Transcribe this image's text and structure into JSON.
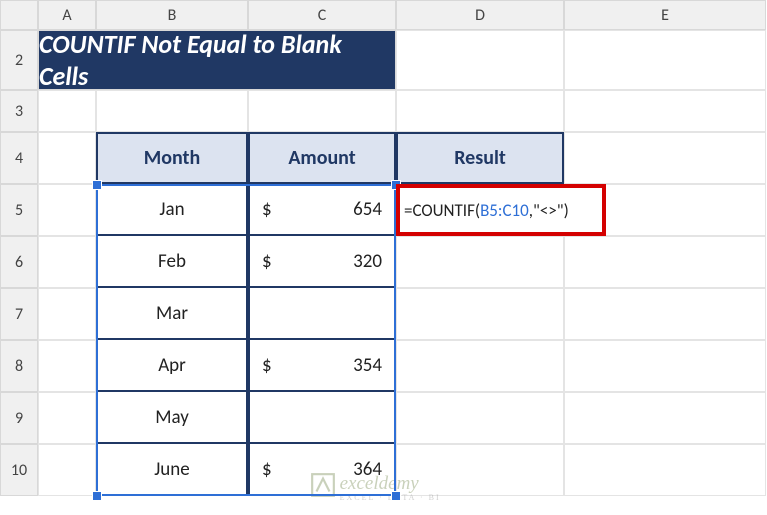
{
  "columns": [
    "A",
    "B",
    "C",
    "D",
    "E"
  ],
  "rows": [
    "2",
    "3",
    "4",
    "5",
    "6",
    "7",
    "8",
    "9",
    "10"
  ],
  "title": "COUNTIF Not Equal to Blank Cells",
  "table": {
    "headers": {
      "month": "Month",
      "amount": "Amount",
      "result": "Result"
    },
    "rows": [
      {
        "month": "Jan",
        "currency": "$",
        "amount": "654"
      },
      {
        "month": "Feb",
        "currency": "$",
        "amount": "320"
      },
      {
        "month": "Mar",
        "currency": "",
        "amount": ""
      },
      {
        "month": "Apr",
        "currency": "$",
        "amount": "354"
      },
      {
        "month": "May",
        "currency": "",
        "amount": ""
      },
      {
        "month": "June",
        "currency": "$",
        "amount": "364"
      }
    ]
  },
  "formula": {
    "prefix": "=COUNTIF(",
    "range": "B5:C10",
    "suffix": ",\"<>\")"
  },
  "watermark": {
    "brand": "exceldemy",
    "tagline": "EXCEL · DATA · BI"
  },
  "chart_data": {
    "type": "table",
    "title": "COUNTIF Not Equal to Blank Cells",
    "columns": [
      "Month",
      "Amount"
    ],
    "rows": [
      [
        "Jan",
        654
      ],
      [
        "Feb",
        320
      ],
      [
        "Mar",
        null
      ],
      [
        "Apr",
        354
      ],
      [
        "May",
        null
      ],
      [
        "June",
        364
      ]
    ],
    "formula_in_D5": "=COUNTIF(B5:C10,\"<>\")"
  }
}
